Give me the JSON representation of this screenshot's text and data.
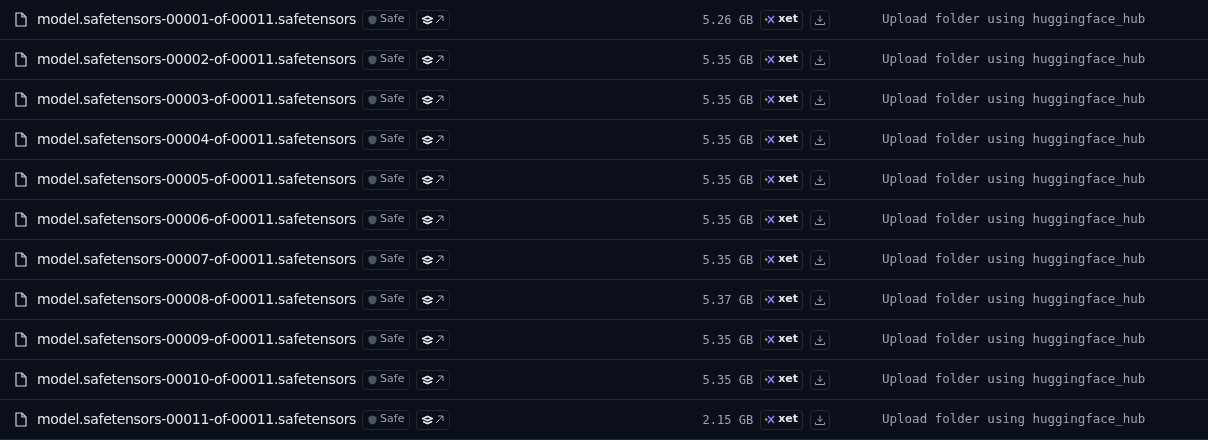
{
  "files": [
    {
      "name": "model.safetensors-00001-of-00011.safetensors",
      "badge": "Safe",
      "size": "5.26 GB",
      "storage": "xet",
      "commit": "Upload folder using huggingface_hub"
    },
    {
      "name": "model.safetensors-00002-of-00011.safetensors",
      "badge": "Safe",
      "size": "5.35 GB",
      "storage": "xet",
      "commit": "Upload folder using huggingface_hub"
    },
    {
      "name": "model.safetensors-00003-of-00011.safetensors",
      "badge": "Safe",
      "size": "5.35 GB",
      "storage": "xet",
      "commit": "Upload folder using huggingface_hub"
    },
    {
      "name": "model.safetensors-00004-of-00011.safetensors",
      "badge": "Safe",
      "size": "5.35 GB",
      "storage": "xet",
      "commit": "Upload folder using huggingface_hub"
    },
    {
      "name": "model.safetensors-00005-of-00011.safetensors",
      "badge": "Safe",
      "size": "5.35 GB",
      "storage": "xet",
      "commit": "Upload folder using huggingface_hub"
    },
    {
      "name": "model.safetensors-00006-of-00011.safetensors",
      "badge": "Safe",
      "size": "5.35 GB",
      "storage": "xet",
      "commit": "Upload folder using huggingface_hub"
    },
    {
      "name": "model.safetensors-00007-of-00011.safetensors",
      "badge": "Safe",
      "size": "5.35 GB",
      "storage": "xet",
      "commit": "Upload folder using huggingface_hub"
    },
    {
      "name": "model.safetensors-00008-of-00011.safetensors",
      "badge": "Safe",
      "size": "5.37 GB",
      "storage": "xet",
      "commit": "Upload folder using huggingface_hub"
    },
    {
      "name": "model.safetensors-00009-of-00011.safetensors",
      "badge": "Safe",
      "size": "5.35 GB",
      "storage": "xet",
      "commit": "Upload folder using huggingface_hub"
    },
    {
      "name": "model.safetensors-00010-of-00011.safetensors",
      "badge": "Safe",
      "size": "5.35 GB",
      "storage": "xet",
      "commit": "Upload folder using huggingface_hub"
    },
    {
      "name": "model.safetensors-00011-of-00011.safetensors",
      "badge": "Safe",
      "size": "2.15 GB",
      "storage": "xet",
      "commit": "Upload folder using huggingface_hub"
    }
  ]
}
